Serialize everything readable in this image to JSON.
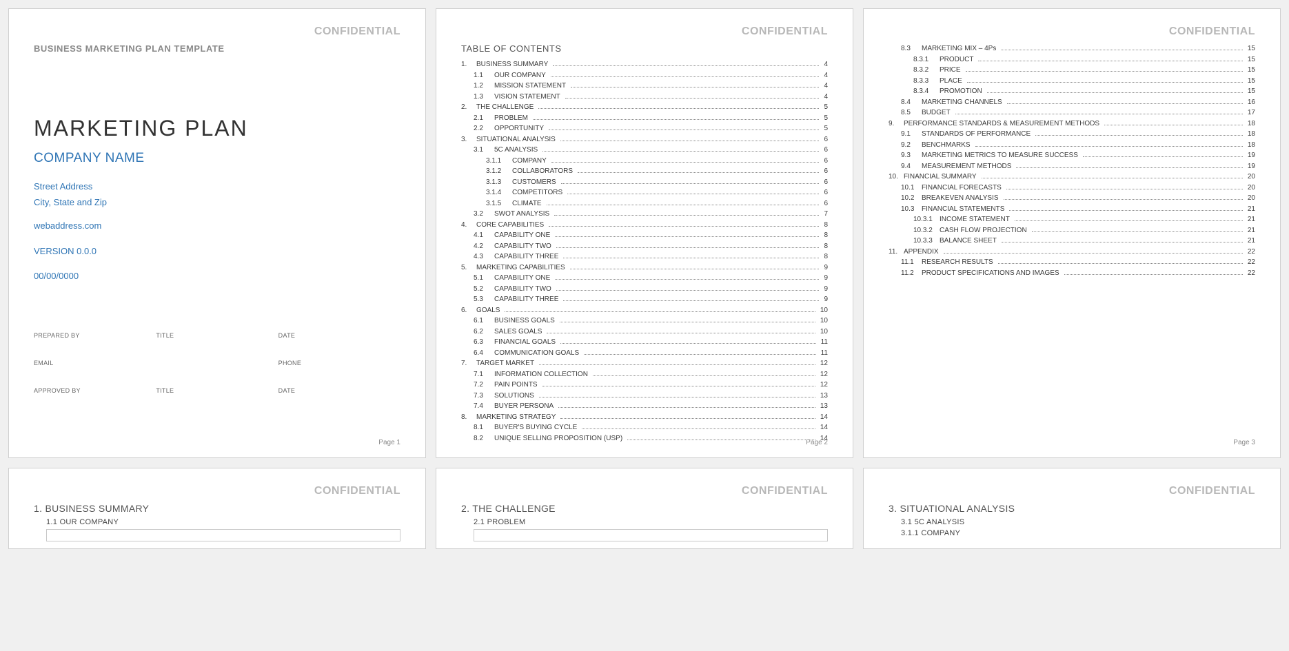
{
  "confidential": "CONFIDENTIAL",
  "page1": {
    "templateLabel": "BUSINESS MARKETING PLAN TEMPLATE",
    "title": "MARKETING PLAN",
    "company": "COMPANY NAME",
    "street": "Street Address",
    "cityStateZip": "City, State and Zip",
    "web": "webaddress.com",
    "version": "VERSION 0.0.0",
    "date": "00/00/0000",
    "form": {
      "preparedBy": "PREPARED BY",
      "title": "TITLE",
      "dateLbl": "DATE",
      "email": "EMAIL",
      "phone": "PHONE",
      "approvedBy": "APPROVED BY"
    },
    "pageNum": "Page 1"
  },
  "page2": {
    "tocTitle": "TABLE OF CONTENTS",
    "toc": [
      {
        "lvl": 1,
        "num": "1.",
        "label": "BUSINESS SUMMARY",
        "pg": "4"
      },
      {
        "lvl": 2,
        "num": "1.1",
        "label": "OUR COMPANY",
        "pg": "4"
      },
      {
        "lvl": 2,
        "num": "1.2",
        "label": "MISSION STATEMENT",
        "pg": "4"
      },
      {
        "lvl": 2,
        "num": "1.3",
        "label": "VISION STATEMENT",
        "pg": "4"
      },
      {
        "lvl": 1,
        "num": "2.",
        "label": "THE CHALLENGE",
        "pg": "5"
      },
      {
        "lvl": 2,
        "num": "2.1",
        "label": "PROBLEM",
        "pg": "5"
      },
      {
        "lvl": 2,
        "num": "2.2",
        "label": "OPPORTUNITY",
        "pg": "5"
      },
      {
        "lvl": 1,
        "num": "3.",
        "label": "SITUATIONAL ANALYSIS",
        "pg": "6"
      },
      {
        "lvl": 2,
        "num": "3.1",
        "label": "5C ANALYSIS",
        "pg": "6"
      },
      {
        "lvl": 3,
        "num": "3.1.1",
        "label": "COMPANY",
        "pg": "6"
      },
      {
        "lvl": 3,
        "num": "3.1.2",
        "label": "COLLABORATORS",
        "pg": "6"
      },
      {
        "lvl": 3,
        "num": "3.1.3",
        "label": "CUSTOMERS",
        "pg": "6"
      },
      {
        "lvl": 3,
        "num": "3.1.4",
        "label": "COMPETITORS",
        "pg": "6"
      },
      {
        "lvl": 3,
        "num": "3.1.5",
        "label": "CLIMATE",
        "pg": "6"
      },
      {
        "lvl": 2,
        "num": "3.2",
        "label": "SWOT ANALYSIS",
        "pg": "7"
      },
      {
        "lvl": 1,
        "num": "4.",
        "label": "CORE CAPABILITIES",
        "pg": "8"
      },
      {
        "lvl": 2,
        "num": "4.1",
        "label": "CAPABILITY ONE",
        "pg": "8"
      },
      {
        "lvl": 2,
        "num": "4.2",
        "label": "CAPABILITY TWO",
        "pg": "8"
      },
      {
        "lvl": 2,
        "num": "4.3",
        "label": "CAPABILITY THREE",
        "pg": "8"
      },
      {
        "lvl": 1,
        "num": "5.",
        "label": "MARKETING CAPABILITIES",
        "pg": "9"
      },
      {
        "lvl": 2,
        "num": "5.1",
        "label": "CAPABILITY ONE",
        "pg": "9"
      },
      {
        "lvl": 2,
        "num": "5.2",
        "label": "CAPABILITY TWO",
        "pg": "9"
      },
      {
        "lvl": 2,
        "num": "5.3",
        "label": "CAPABILITY THREE",
        "pg": "9"
      },
      {
        "lvl": 1,
        "num": "6.",
        "label": "GOALS",
        "pg": "10"
      },
      {
        "lvl": 2,
        "num": "6.1",
        "label": "BUSINESS GOALS",
        "pg": "10"
      },
      {
        "lvl": 2,
        "num": "6.2",
        "label": "SALES GOALS",
        "pg": "10"
      },
      {
        "lvl": 2,
        "num": "6.3",
        "label": "FINANCIAL GOALS",
        "pg": "11"
      },
      {
        "lvl": 2,
        "num": "6.4",
        "label": "COMMUNICATION GOALS",
        "pg": "11"
      },
      {
        "lvl": 1,
        "num": "7.",
        "label": "TARGET MARKET",
        "pg": "12"
      },
      {
        "lvl": 2,
        "num": "7.1",
        "label": "INFORMATION COLLECTION",
        "pg": "12"
      },
      {
        "lvl": 2,
        "num": "7.2",
        "label": "PAIN POINTS",
        "pg": "12"
      },
      {
        "lvl": 2,
        "num": "7.3",
        "label": "SOLUTIONS",
        "pg": "13"
      },
      {
        "lvl": 2,
        "num": "7.4",
        "label": "BUYER PERSONA",
        "pg": "13"
      },
      {
        "lvl": 1,
        "num": "8.",
        "label": "MARKETING STRATEGY",
        "pg": "14"
      },
      {
        "lvl": 2,
        "num": "8.1",
        "label": "BUYER'S BUYING CYCLE",
        "pg": "14"
      },
      {
        "lvl": 2,
        "num": "8.2",
        "label": "UNIQUE SELLING PROPOSITION (USP)",
        "pg": "14"
      }
    ],
    "pageNum": "Page 2"
  },
  "page3": {
    "toc": [
      {
        "lvl": 2,
        "num": "8.3",
        "label": "MARKETING MIX – 4Ps",
        "pg": "15"
      },
      {
        "lvl": 3,
        "num": "8.3.1",
        "label": "PRODUCT",
        "pg": "15"
      },
      {
        "lvl": 3,
        "num": "8.3.2",
        "label": "PRICE",
        "pg": "15"
      },
      {
        "lvl": 3,
        "num": "8.3.3",
        "label": "PLACE",
        "pg": "15"
      },
      {
        "lvl": 3,
        "num": "8.3.4",
        "label": "PROMOTION",
        "pg": "15"
      },
      {
        "lvl": 2,
        "num": "8.4",
        "label": "MARKETING CHANNELS",
        "pg": "16"
      },
      {
        "lvl": 2,
        "num": "8.5",
        "label": "BUDGET",
        "pg": "17"
      },
      {
        "lvl": 1,
        "num": "9.",
        "label": "PERFORMANCE STANDARDS & MEASUREMENT METHODS",
        "pg": "18"
      },
      {
        "lvl": 2,
        "num": "9.1",
        "label": "STANDARDS OF PERFORMANCE",
        "pg": "18"
      },
      {
        "lvl": 2,
        "num": "9.2",
        "label": "BENCHMARKS",
        "pg": "18"
      },
      {
        "lvl": 2,
        "num": "9.3",
        "label": "MARKETING METRICS TO MEASURE SUCCESS",
        "pg": "19"
      },
      {
        "lvl": 2,
        "num": "9.4",
        "label": "MEASUREMENT METHODS",
        "pg": "19"
      },
      {
        "lvl": 1,
        "num": "10.",
        "label": "FINANCIAL SUMMARY",
        "pg": "20"
      },
      {
        "lvl": 2,
        "num": "10.1",
        "label": "FINANCIAL FORECASTS",
        "pg": "20"
      },
      {
        "lvl": 2,
        "num": "10.2",
        "label": "BREAKEVEN ANALYSIS",
        "pg": "20"
      },
      {
        "lvl": 2,
        "num": "10.3",
        "label": "FINANCIAL STATEMENTS",
        "pg": "21"
      },
      {
        "lvl": 3,
        "num": "10.3.1",
        "label": "INCOME STATEMENT",
        "pg": "21"
      },
      {
        "lvl": 3,
        "num": "10.3.2",
        "label": "CASH FLOW PROJECTION",
        "pg": "21"
      },
      {
        "lvl": 3,
        "num": "10.3.3",
        "label": "BALANCE SHEET",
        "pg": "21"
      },
      {
        "lvl": 1,
        "num": "11.",
        "label": "APPENDIX",
        "pg": "22"
      },
      {
        "lvl": 2,
        "num": "11.1",
        "label": "RESEARCH RESULTS",
        "pg": "22"
      },
      {
        "lvl": 2,
        "num": "11.2",
        "label": "PRODUCT SPECIFICATIONS AND IMAGES",
        "pg": "22"
      }
    ],
    "pageNum": "Page 3"
  },
  "page4": {
    "h1num": "1.",
    "h1": "BUSINESS SUMMARY",
    "h2num": "1.1",
    "h2": "OUR COMPANY"
  },
  "page5": {
    "h1num": "2.",
    "h1": "THE CHALLENGE",
    "h2num": "2.1",
    "h2": "PROBLEM"
  },
  "page6": {
    "h1num": "3.",
    "h1": "SITUATIONAL ANALYSIS",
    "h2num": "3.1",
    "h2": "5C ANALYSIS",
    "h3num": "3.1.1",
    "h3": "COMPANY"
  }
}
